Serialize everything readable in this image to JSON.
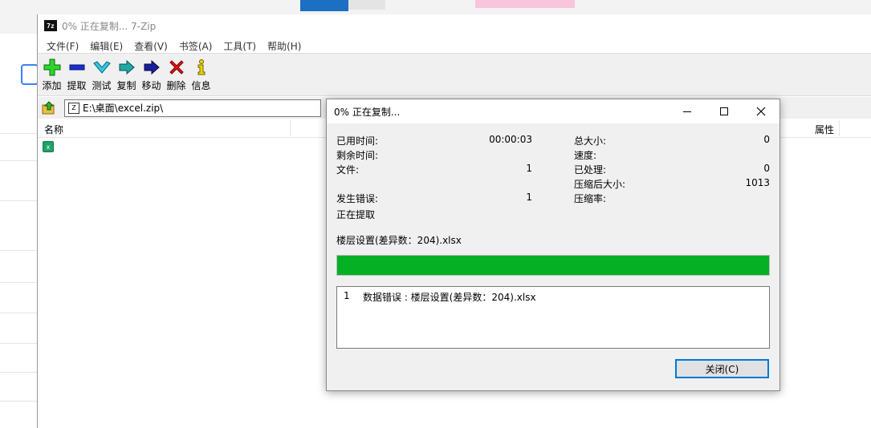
{
  "main_window": {
    "title": "0% 正在复制... 7-Zip",
    "app_icon_text": "7z",
    "menu": [
      "文件(F)",
      "编辑(E)",
      "查看(V)",
      "书签(A)",
      "工具(T)",
      "帮助(H)"
    ],
    "toolbar": {
      "add": "添加",
      "extract": "提取",
      "test": "测试",
      "copy": "复制",
      "move": "移动",
      "delete": "删除",
      "info": "信息"
    },
    "address": "E:\\桌面\\excel.zip\\",
    "columns": {
      "name": "名称",
      "attributes": "属性"
    }
  },
  "dialog": {
    "title": "0% 正在复制...",
    "elapsed_label": "已用时间:",
    "elapsed_value": "00:00:03",
    "remaining_label": "剩余时间:",
    "files_label": "文件:",
    "files_value": "1",
    "errors_label": "发生错误:",
    "errors_value": "1",
    "status": "正在提取",
    "total_size_label": "总大小:",
    "total_size_value": "0",
    "speed_label": "速度:",
    "processed_label": "已处理:",
    "processed_value": "0",
    "compressed_label": "压缩后大小:",
    "compressed_value": "1013",
    "ratio_label": "压缩率:",
    "current_file": "楼层设置(差异数：204).xlsx",
    "progress": 1.0,
    "error_index": "1",
    "error_message": "数据错误 : 楼层设置(差异数：204).xlsx",
    "close_button": "关闭(C)"
  },
  "colors": {
    "progress": "#06b025",
    "focus_border": "#0078d7"
  }
}
